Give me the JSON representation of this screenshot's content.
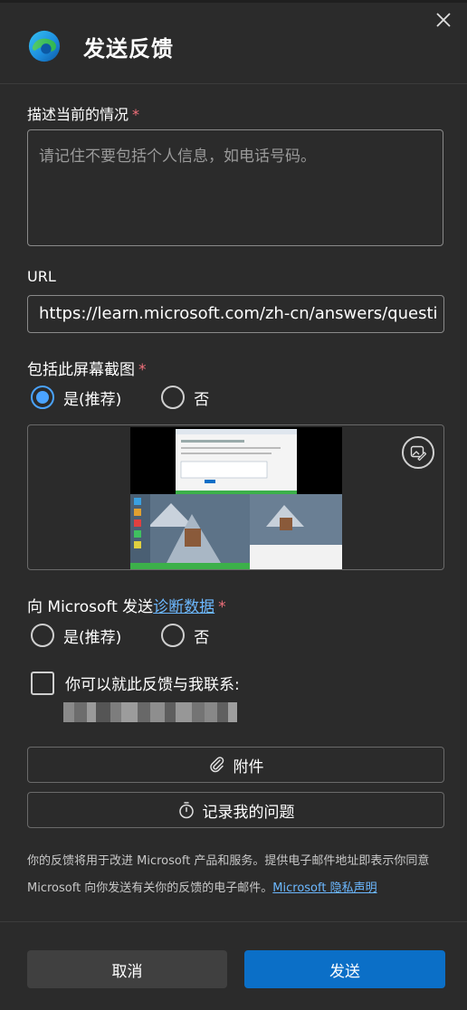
{
  "dialog": {
    "title": "发送反馈",
    "close_icon": "close-icon"
  },
  "description": {
    "label": "描述当前的情况",
    "required_mark": "*",
    "placeholder": "请记住不要包括个人信息，如电话号码。"
  },
  "url": {
    "label": "URL",
    "value": "https://learn.microsoft.com/zh-cn/answers/questi"
  },
  "screenshot": {
    "label": "包括此屏幕截图",
    "required_mark": "*",
    "options": [
      "是(推荐)",
      "否"
    ],
    "selected": "是(推荐)",
    "edit_icon": "image-edit-icon"
  },
  "diagnostics": {
    "label_prefix": "向 Microsoft 发送",
    "link_text": "诊断数据",
    "required_mark": "*",
    "options": [
      "是(推荐)",
      "否"
    ]
  },
  "contact": {
    "label": "你可以就此反馈与我联系:"
  },
  "buttons": {
    "attachment": "附件",
    "record": "记录我的问题",
    "cancel": "取消",
    "send": "发送"
  },
  "footer": {
    "line1": "你的反馈将用于改进 Microsoft 产品和服务。提供电子邮件地址即表示你同意",
    "line2": "Microsoft 向你发送有关你的反馈的电子邮件。",
    "privacy_link": "Microsoft 隐私声明"
  },
  "colors": {
    "background": "#2b2b2b",
    "accent": "#0b6fc7",
    "link": "#6cb8ff",
    "required": "#f1707b"
  }
}
